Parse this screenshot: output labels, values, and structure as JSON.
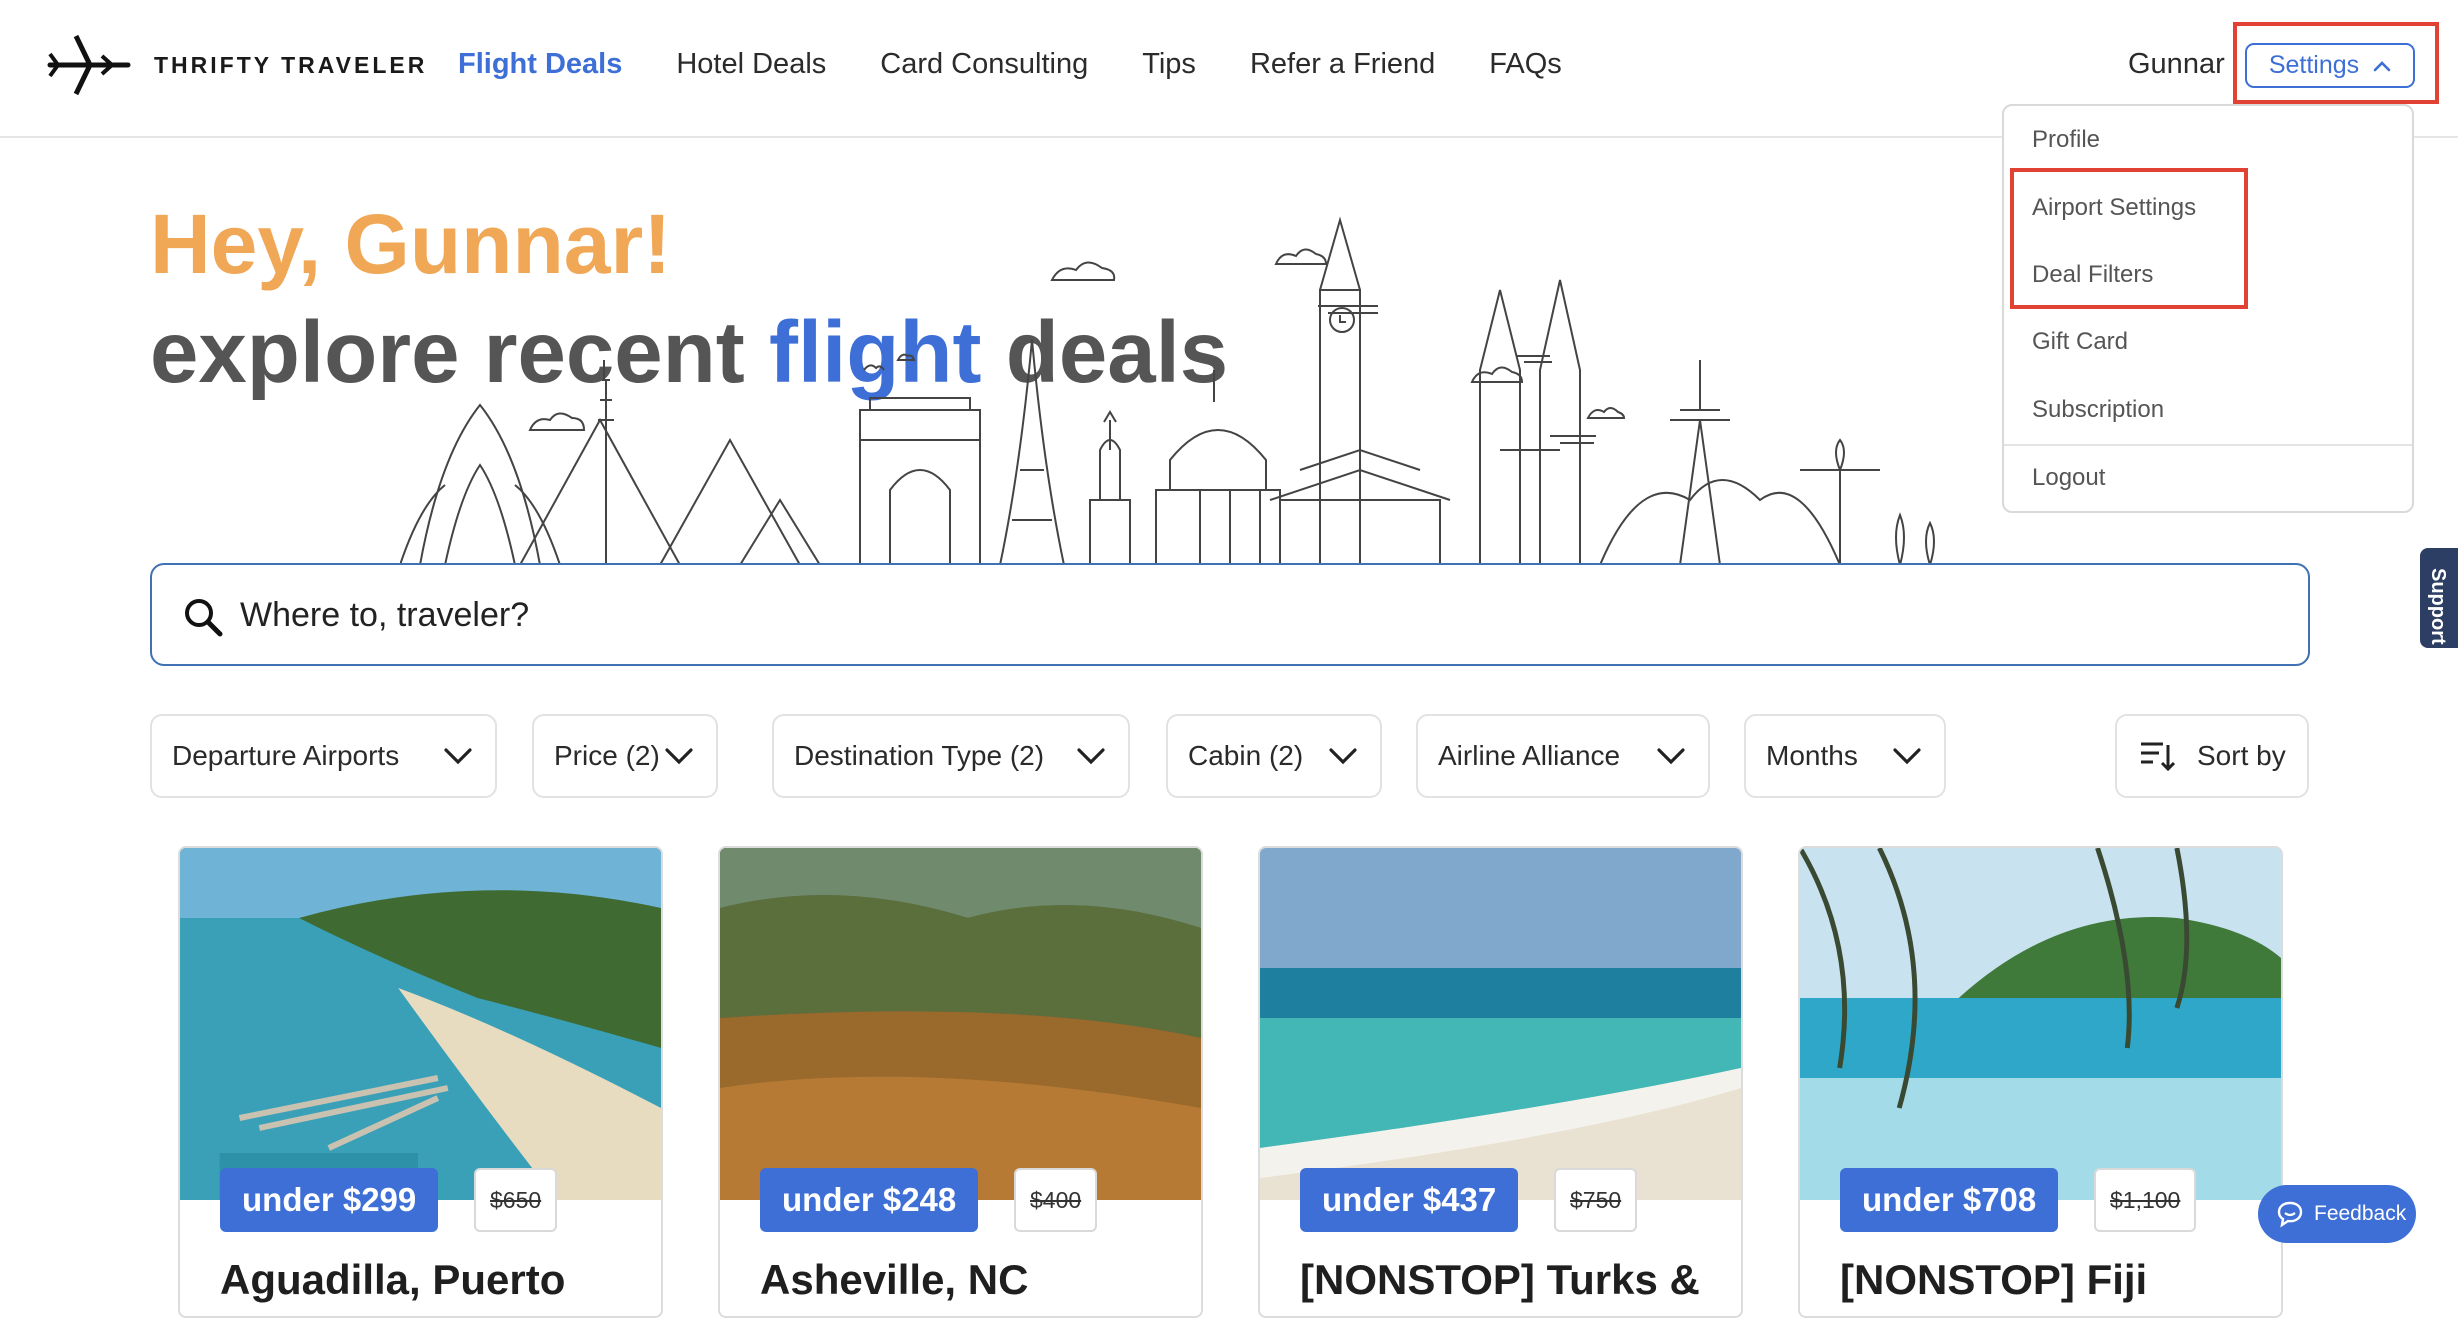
{
  "header": {
    "brand": "THRIFTY TRAVELER",
    "nav": [
      "Flight Deals",
      "Hotel Deals",
      "Card Consulting",
      "Tips",
      "Refer a Friend",
      "FAQs"
    ],
    "active_nav": "Flight Deals",
    "user_name": "Gunnar",
    "settings_label": "Settings"
  },
  "settings_menu": {
    "items": [
      "Profile",
      "Airport Settings",
      "Deal Filters",
      "Gift Card",
      "Subscription",
      "Logout"
    ]
  },
  "hero": {
    "greeting": "Hey, Gunnar!",
    "line2_prefix": "explore recent",
    "line2_highlight": "flight",
    "line2_suffix": "deals"
  },
  "search": {
    "placeholder": "Where to, traveler?"
  },
  "filters": [
    "Departure Airports",
    "Price (2)",
    "Destination Type (2)",
    "Cabin (2)",
    "Airline Alliance",
    "Months"
  ],
  "sort_label": "Sort by",
  "deals": [
    {
      "price": "under $299",
      "original": "$650",
      "title": "Aguadilla, Puerto"
    },
    {
      "price": "under $248",
      "original": "$400",
      "title": "Asheville, NC"
    },
    {
      "price": "under $437",
      "original": "$750",
      "title": "[NONSTOP] Turks &"
    },
    {
      "price": "under $708",
      "original": "$1,100",
      "title": "[NONSTOP] Fiji"
    }
  ],
  "support_label": "Support",
  "feedback_label": "Feedback",
  "colors": {
    "accent": "#3d6fd6",
    "greeting": "#f0a756",
    "highlight_box": "#e14233",
    "support_tab": "#2c3e63"
  }
}
